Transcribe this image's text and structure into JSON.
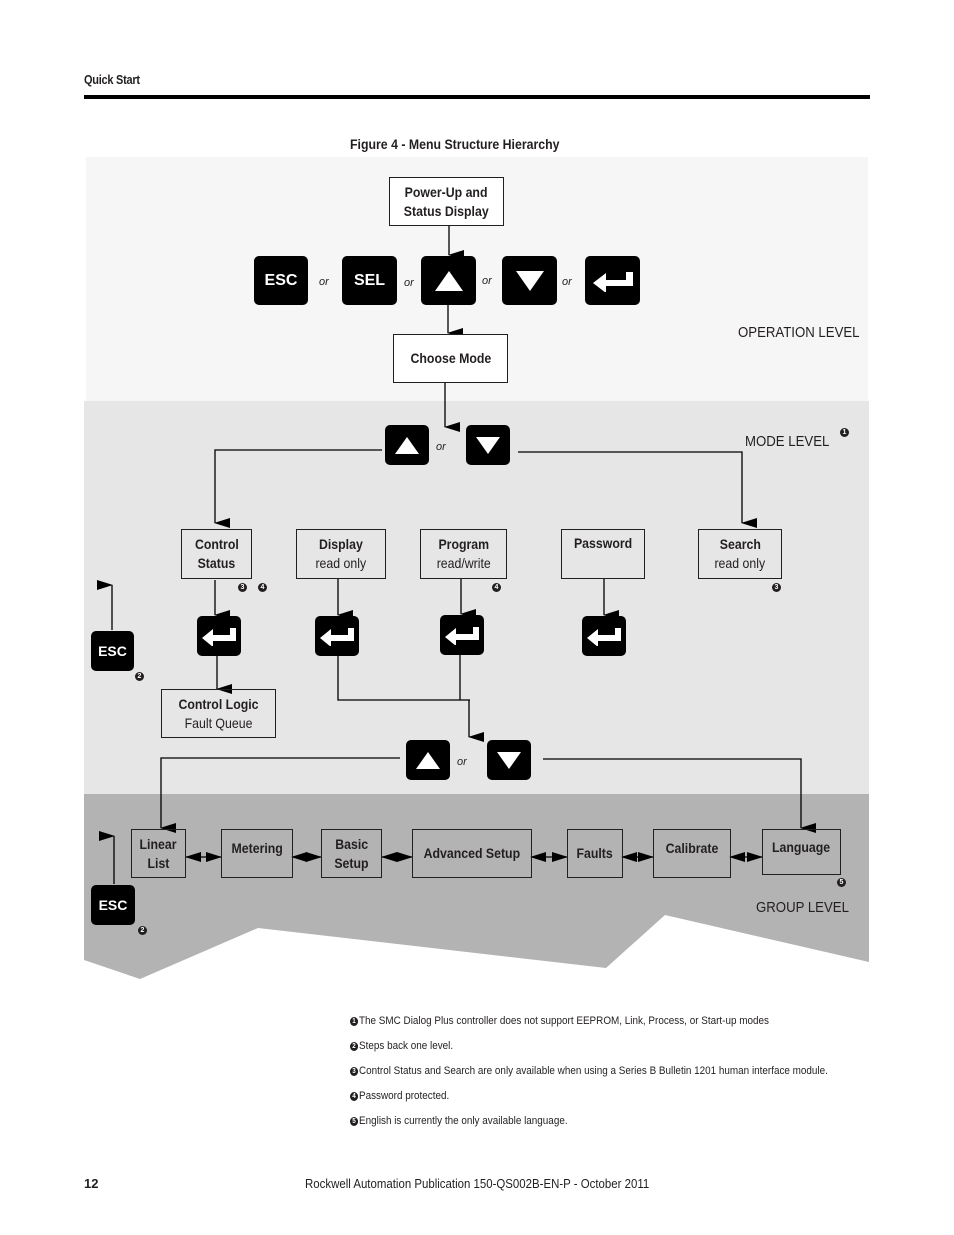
{
  "header": {
    "section": "Quick Start"
  },
  "figure": {
    "title": "Figure 4 - Menu Structure Hierarchy"
  },
  "levels": {
    "operation": "OPERATION LEVEL",
    "mode": "MODE LEVEL",
    "group": "GROUP LEVEL"
  },
  "colors": {
    "operation_bg": "#f6f6f6",
    "mode_bg": "#e6e6e6",
    "group_bg": "#b3b3b3",
    "key_bg": "#000000"
  },
  "operation": {
    "power_up": {
      "line1": "Power-Up and",
      "line2": "Status Display"
    },
    "keys": {
      "esc": "ESC",
      "sel": "SEL",
      "up": "up-arrow-key",
      "down": "down-arrow-key",
      "enter": "enter-key"
    },
    "or": "or",
    "choose_mode": "Choose Mode"
  },
  "mode": {
    "or": "or",
    "items": [
      {
        "title": "Control",
        "title2": "Status",
        "sub": "",
        "notes": [
          "3",
          "4"
        ]
      },
      {
        "title": "Display",
        "sub": "read only",
        "notes": []
      },
      {
        "title": "Program",
        "sub": "read/write",
        "notes": [
          "4"
        ]
      },
      {
        "title": "Password",
        "sub": "",
        "notes": []
      },
      {
        "title": "Search",
        "sub": "read only",
        "notes": [
          "3"
        ]
      }
    ],
    "control_logic": {
      "title": "Control Logic",
      "sub": "Fault Queue"
    },
    "esc": "ESC",
    "esc_note": "2",
    "level_note": "1"
  },
  "group": {
    "or": "or",
    "items": [
      {
        "line1": "Linear",
        "line2": "List"
      },
      {
        "line1": "Metering",
        "line2": ""
      },
      {
        "line1": "Basic",
        "line2": "Setup"
      },
      {
        "line1": "Advanced Setup",
        "line2": ""
      },
      {
        "line1": "Faults",
        "line2": ""
      },
      {
        "line1": "Calibrate",
        "line2": ""
      },
      {
        "line1": "Language",
        "line2": ""
      }
    ],
    "language_note": "5",
    "esc": "ESC",
    "esc_note": "2"
  },
  "footnotes": [
    {
      "num": "1",
      "text": "The SMC Dialog Plus controller does not support EEPROM, Link, Process, or Start-up modes"
    },
    {
      "num": "2",
      "text": "Steps back one level."
    },
    {
      "num": "3",
      "text": "Control Status and Search are only available when using a Series B Bulletin 1201 human interface module."
    },
    {
      "num": "4",
      "text": "Password protected."
    },
    {
      "num": "5",
      "text": "English is currently the only available language."
    }
  ],
  "footer": {
    "page_number": "12",
    "publication": "Rockwell Automation Publication  150-QS002B-EN-P - October 2011"
  }
}
